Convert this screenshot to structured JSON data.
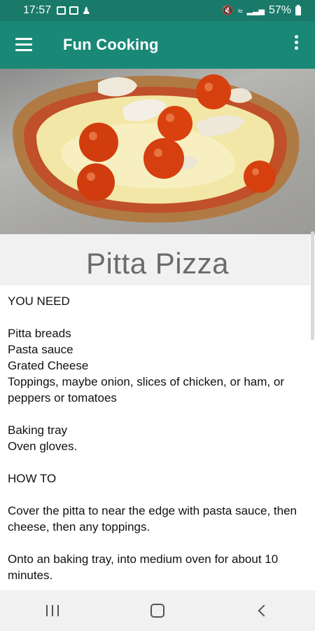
{
  "status_bar": {
    "time": "17:57",
    "battery": "57%",
    "icons": [
      "image-icon",
      "mail-icon",
      "person-icon",
      "mute-icon",
      "wifi-icon",
      "signal-icon",
      "battery-icon"
    ]
  },
  "app_bar": {
    "title": "Fun Cooking",
    "menu_icon": "hamburger-icon",
    "overflow_icon": "more-vert-icon",
    "color": "#1a8877"
  },
  "recipe": {
    "title": "Pitta Pizza",
    "lines": [
      "YOU NEED",
      "",
      "Pitta breads",
      "Pasta sauce",
      "Grated Cheese",
      "Toppings, maybe onion, slices of chicken, or ham, or peppers or tomatoes",
      "",
      "Baking tray",
      "Oven gloves.",
      "",
      "HOW TO",
      "",
      "Cover the pitta to near the edge with pasta sauce, then cheese, then any toppings.",
      "",
      "Onto an baking tray, into medium oven for about 10 minutes."
    ]
  },
  "nav_bar": {
    "icons": [
      "recents-icon",
      "home-icon",
      "back-icon"
    ]
  }
}
